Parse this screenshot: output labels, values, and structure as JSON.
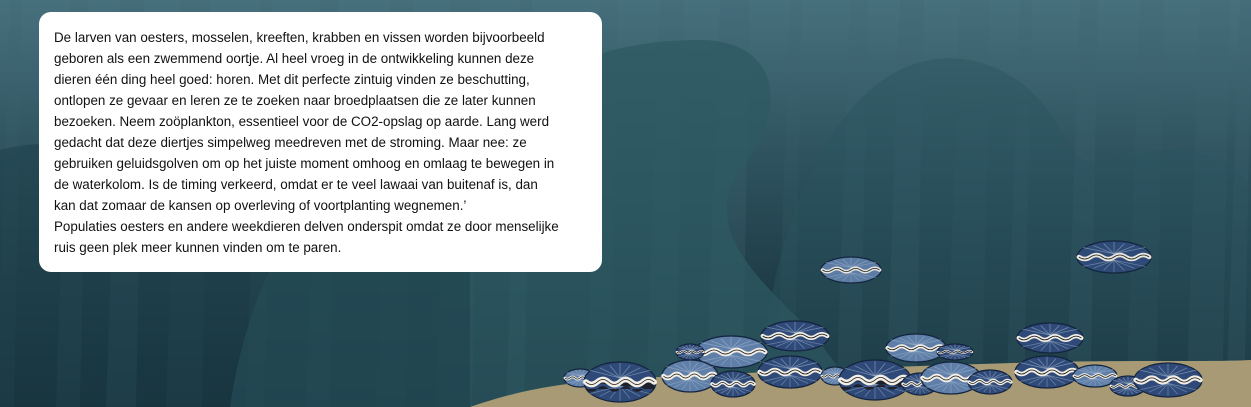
{
  "card": {
    "text": "De larven van oesters, mosselen, kreeften, krabben en vissen worden bijvoorbeeld\ngeboren als een zwemmend oortje. Al heel vroeg in de ontwikkeling kunnen deze\ndieren één ding heel goed: horen. Met dit perfecte zintuig vinden ze beschutting,\nontlopen ze gevaar en leren ze te zoeken naar broedplaatsen die ze later kunnen\nbezoeken. Neem zoöplankton, essentieel voor de CO2-opslag op aarde. Lang werd\ngedacht dat deze diertjes simpelweg meedreven met de stroming. Maar nee: ze\ngebruiken geluidsgolven om op het juiste moment omhoog en omlaag te bewegen in\nde waterkolom. Is de timing verkeerd, omdat er te veel lawaai van buitenaf is, dan\nkan dat zomaar de kansen op overleving of voortplanting wegnemen.’\nPopulaties oesters en andere weekdieren delven onderspit omdat ze door menselijke\nruis geen plek meer kunnen vinden om te paren."
  },
  "scene": {
    "water_color": "#1d3b47",
    "ray_color": "#3f6470",
    "rock_color": "#2f5560",
    "sand_color": "#a89a74",
    "shell_blue": "#5f7fa8",
    "shell_dark": "#2f4a78",
    "shell_black": "#1c1c22",
    "lip_color": "#f3efe6",
    "icons": [
      "oyster-icon",
      "mussel-icon"
    ]
  }
}
